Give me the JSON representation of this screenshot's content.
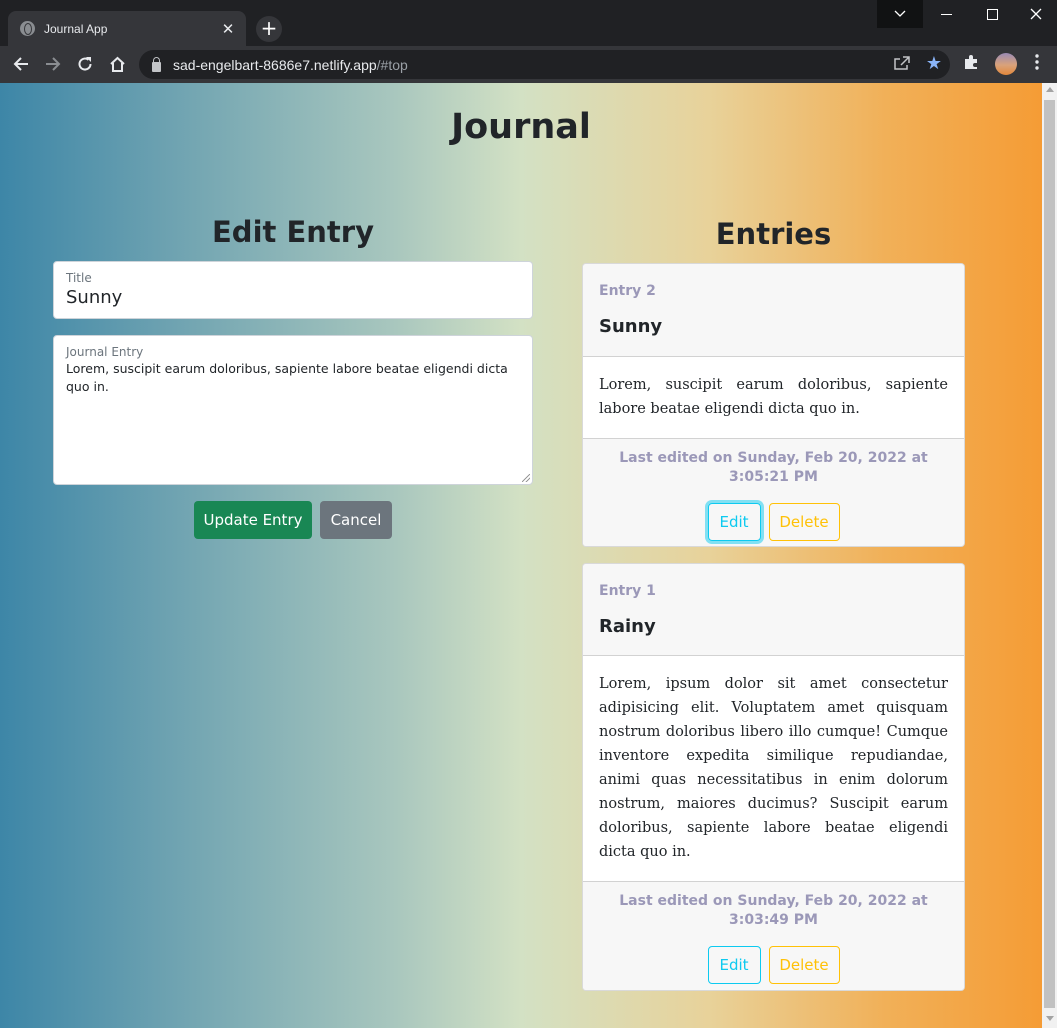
{
  "browser": {
    "tab_title": "Journal App",
    "tab_close": "✕",
    "new_tab": "+",
    "url_host": "sad-engelbart-8686e7.netlify.app",
    "url_path": "/#top"
  },
  "icons": {
    "back": "arrow-left-icon",
    "forward": "arrow-right-icon",
    "reload": "reload-icon",
    "home": "home-icon",
    "share": "share-icon",
    "bookmark": "star-icon",
    "extensions": "puzzle-icon",
    "menu": "kebab-menu-icon"
  },
  "colors": {
    "gradient": [
      "#3d86a7",
      "#d3e1c4",
      "#f59c35"
    ],
    "update_button": "#198754",
    "cancel_button": "#6c757d",
    "edit_button": "#0dcaf0",
    "delete_button": "#ffc107"
  },
  "page": {
    "title": "Journal"
  },
  "form": {
    "heading": "Edit Entry",
    "title_label": "Title",
    "title_value": "Sunny",
    "entry_label": "Journal Entry",
    "entry_value": "Lorem, suscipit earum doloribus, sapiente labore beatae eligendi dicta quo in.",
    "update_label": "Update Entry",
    "cancel_label": "Cancel"
  },
  "entries": {
    "heading": "Entries",
    "items": [
      {
        "number": "Entry 2",
        "title": "Sunny",
        "body": "Lorem, suscipit earum doloribus, sapiente labore beatae eligendi dicta quo in.",
        "meta": "Last edited on Sunday, Feb 20, 2022 at 3:05:21 PM",
        "edit_label": "Edit",
        "delete_label": "Delete"
      },
      {
        "number": "Entry 1",
        "title": "Rainy",
        "body": "Lorem, ipsum dolor sit amet consectetur adipisicing elit. Voluptatem amet quisquam nostrum doloribus libero illo cumque! Cumque inventore expedita similique repudiandae, animi quas necessitatibus in enim dolorum nostrum, maiores ducimus? Suscipit earum doloribus, sapiente labore beatae eligendi dicta quo in.",
        "meta": "Last edited on Sunday, Feb 20, 2022 at 3:03:49 PM",
        "edit_label": "Edit",
        "delete_label": "Delete"
      }
    ]
  }
}
